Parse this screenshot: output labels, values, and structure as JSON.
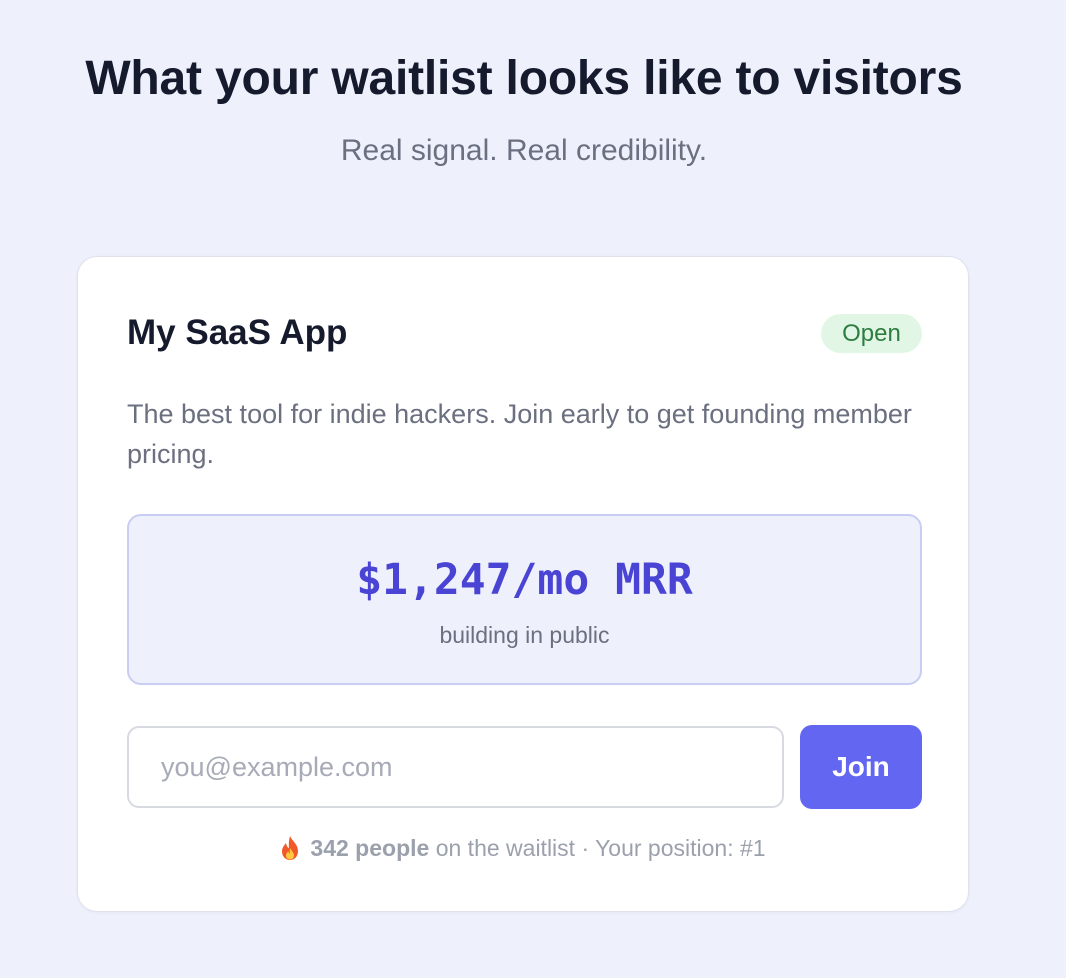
{
  "header": {
    "title": "What your waitlist looks like to visitors",
    "subtitle": "Real signal. Real credibility."
  },
  "card": {
    "app_name": "My SaaS App",
    "status_badge": "Open",
    "description": "The best tool for indie hackers. Join early to get founding member pricing.",
    "mrr": {
      "value": "$1,247/mo MRR",
      "caption": "building in public"
    },
    "form": {
      "email_placeholder": "you@example.com",
      "email_value": "",
      "join_label": "Join"
    },
    "waitlist": {
      "icon": "fire-icon",
      "count_label": "342 people",
      "suffix": "on the waitlist · Your position: #1"
    }
  },
  "colors": {
    "accent": "#6366f1",
    "mrr_text": "#4a44d4",
    "badge_bg": "#e2f6e6",
    "badge_text": "#2e7d40",
    "page_bg": "#eef0fc"
  }
}
